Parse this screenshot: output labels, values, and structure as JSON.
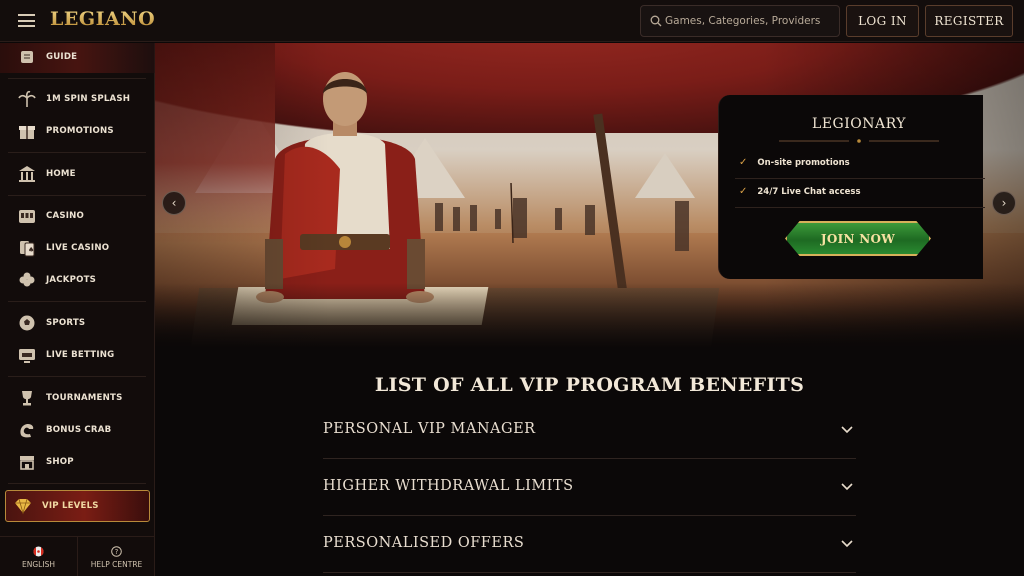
{
  "header": {
    "logo": "LEGIANO",
    "search_placeholder": "Games, Categories, Providers",
    "login_label": "LOG IN",
    "register_label": "REGISTER"
  },
  "sidebar": {
    "items": [
      {
        "label": "GUIDE",
        "icon": "scroll-icon"
      },
      {
        "label": "1M SPIN SPLASH",
        "icon": "palm-tree-icon"
      },
      {
        "label": "PROMOTIONS",
        "icon": "gift-icon"
      },
      {
        "label": "HOME",
        "icon": "temple-icon"
      },
      {
        "label": "CASINO",
        "icon": "slot-machine-icon"
      },
      {
        "label": "LIVE CASINO",
        "icon": "cards-icon"
      },
      {
        "label": "JACKPOTS",
        "icon": "clover-icon"
      },
      {
        "label": "SPORTS",
        "icon": "ball-icon"
      },
      {
        "label": "LIVE BETTING",
        "icon": "live-tv-icon"
      },
      {
        "label": "TOURNAMENTS",
        "icon": "trophy-icon"
      },
      {
        "label": "BONUS CRAB",
        "icon": "claw-icon"
      },
      {
        "label": "SHOP",
        "icon": "shop-icon"
      }
    ],
    "vip": {
      "label": "VIP LEVELS",
      "icon": "diamond-icon"
    },
    "footer": {
      "language": "ENGLISH",
      "help": "HELP CENTRE"
    }
  },
  "promo": {
    "title": "LEGIONARY",
    "benefits": [
      "On-site promotions",
      "24/7 Live Chat access"
    ],
    "join_label": "JOIN NOW"
  },
  "content": {
    "title": "LIST OF ALL VIP PROGRAM BENEFITS",
    "accordion": [
      "PERSONAL VIP MANAGER",
      "HIGHER WITHDRAWAL LIMITS",
      "PERSONALISED OFFERS"
    ]
  },
  "colors": {
    "accent_gold": "#d9a047",
    "join_green": "#2a8a30",
    "brand_red": "#7a1d14"
  }
}
